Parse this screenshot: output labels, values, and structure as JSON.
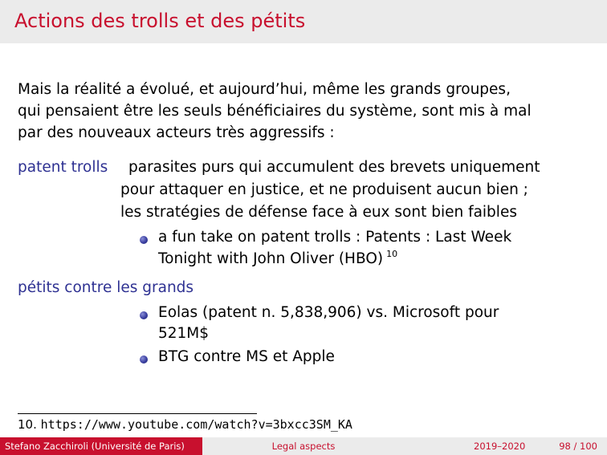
{
  "title": "Actions des trolls et des pétits",
  "intro": [
    "Mais la réalité a évolué, et aujourd’hui, même les grands groupes,",
    "qui pensaient être les seuls bénéficiaires du système, sont mis à mal",
    "par des nouveaux acteurs très aggressifs :"
  ],
  "items": [
    {
      "term": "patent trolls",
      "definition": [
        "parasites purs qui accumulent des brevets uniquement",
        "pour attaquer en justice, et ne produisent aucun bien ;",
        "les stratégies de défense face à eux sont bien faibles"
      ],
      "bullets": [
        [
          "a fun take on patent trolls : Patents : Last Week",
          "Tonight with John Oliver (HBO)"
        ]
      ],
      "footnote_ref": "10"
    },
    {
      "term": "pétits contre les grands",
      "bullets": [
        [
          "Eolas (patent n. 5,838,906) vs. Microsoft pour",
          "521M$"
        ],
        [
          "BTG contre MS et Apple"
        ]
      ]
    }
  ],
  "footnote": {
    "number": "10.",
    "url": "https://www.youtube.com/watch?v=3bxcc3SM_KA"
  },
  "footer": {
    "author": "Stefano Zacchiroli  (Université de Paris)",
    "section": "Legal aspects",
    "year": "2019–2020",
    "page": "98 / 100"
  },
  "colors": {
    "accent_red": "#c8102e",
    "term_blue": "#2e3192",
    "bar_gray": "#ebebeb"
  }
}
